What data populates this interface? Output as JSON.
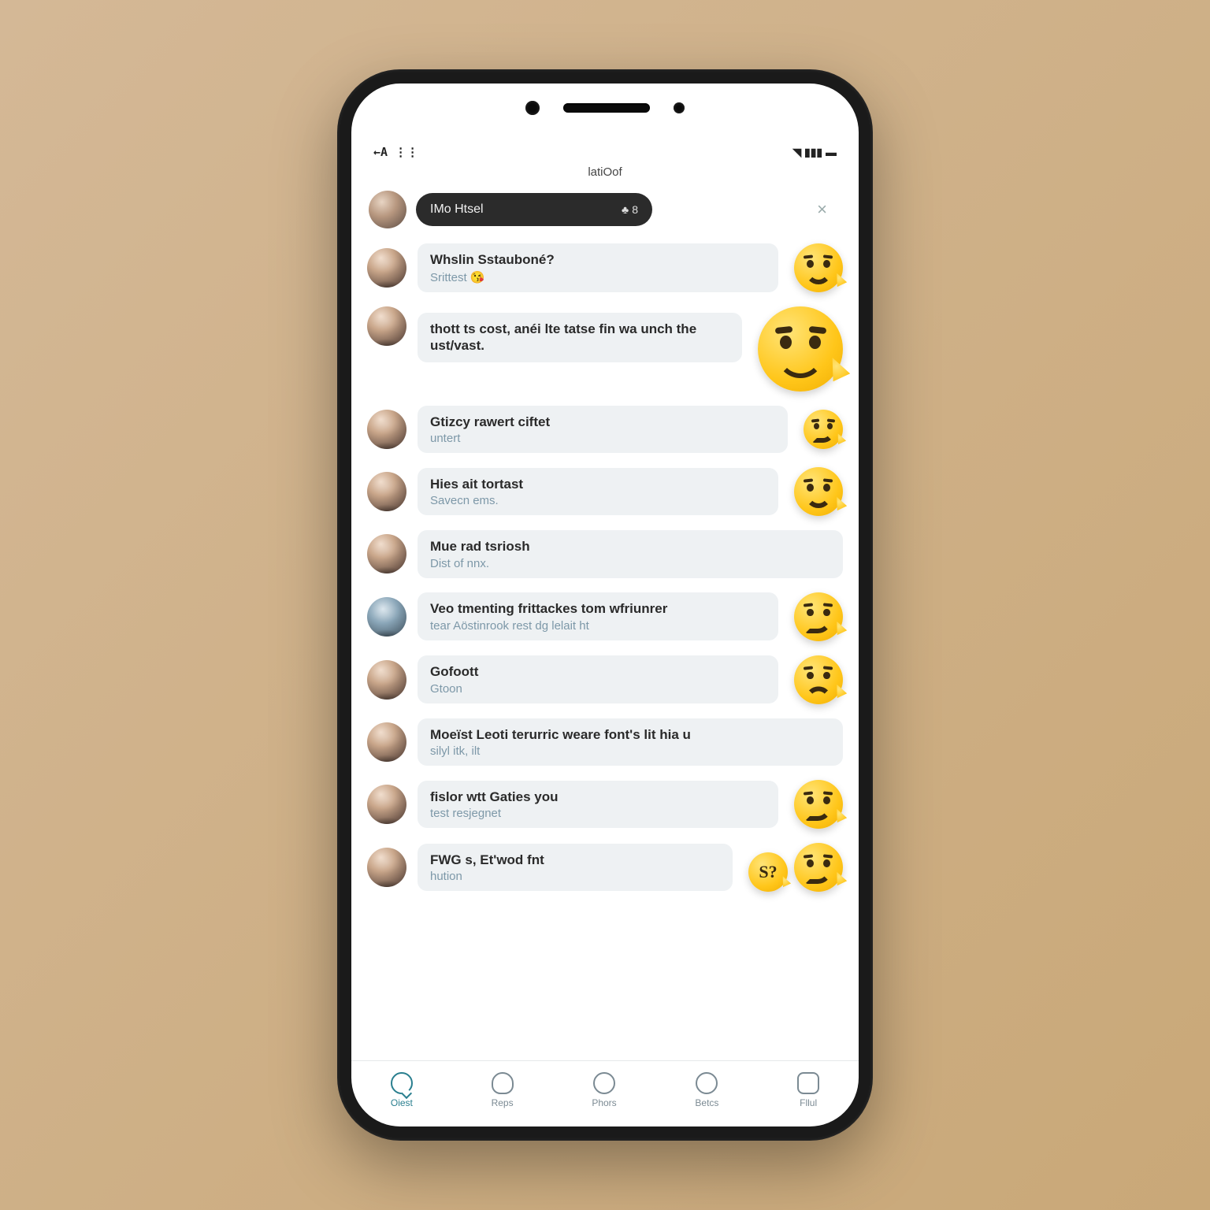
{
  "status": {
    "left": "←A ⋮⋮",
    "title": "latiOof",
    "right_glyphs": "◥ ▮▮▮ ▬"
  },
  "chip": {
    "label": "IMo Htsel",
    "badge": "8"
  },
  "conversations": [
    {
      "title": "Whslin Sstauboné?",
      "sub": "Srittest 😘",
      "emoji": "happy",
      "size": "normal"
    },
    {
      "title": "thott ts cost, anéi lte tatse fin wa unch the ust/vast.",
      "sub": "",
      "emoji": "big-grin",
      "size": "big"
    },
    {
      "title": "Gtizcy rawert ciftet",
      "sub": "untert",
      "emoji": "smirk",
      "size": "small"
    },
    {
      "title": "Hies ait tortast",
      "sub": "Savecn ems.",
      "emoji": "happy",
      "size": "normal"
    },
    {
      "title": "Mue rad tsriosh",
      "sub": "Dist of nnx.",
      "emoji": "none"
    },
    {
      "title": "Veo tmenting frittackes tom wfriunrer",
      "sub": "tear Aöstinrook rest dg lelait ht",
      "emoji": "smirk",
      "size": "normal",
      "alt_avatar": true
    },
    {
      "title": "Gofoott",
      "sub": "Gtoon",
      "emoji": "sad",
      "size": "normal"
    },
    {
      "title": "Moeïst Leoti terurric weare font's lit hia u",
      "sub": "silyl itk, ilt",
      "emoji": "none"
    },
    {
      "title": "fislor wtt Gaties you",
      "sub": "test resjegnet",
      "emoji": "smirk",
      "size": "normal"
    },
    {
      "title": "FWG s, Et'wod fnt",
      "sub": "hution",
      "emoji": "pair"
    }
  ],
  "nav": [
    {
      "label": "Oiest",
      "icon": "bubble"
    },
    {
      "label": "Reps",
      "icon": "people"
    },
    {
      "label": "Phors",
      "icon": "circle"
    },
    {
      "label": "Betcs",
      "icon": "circle"
    },
    {
      "label": "Fllul",
      "icon": "square"
    }
  ]
}
